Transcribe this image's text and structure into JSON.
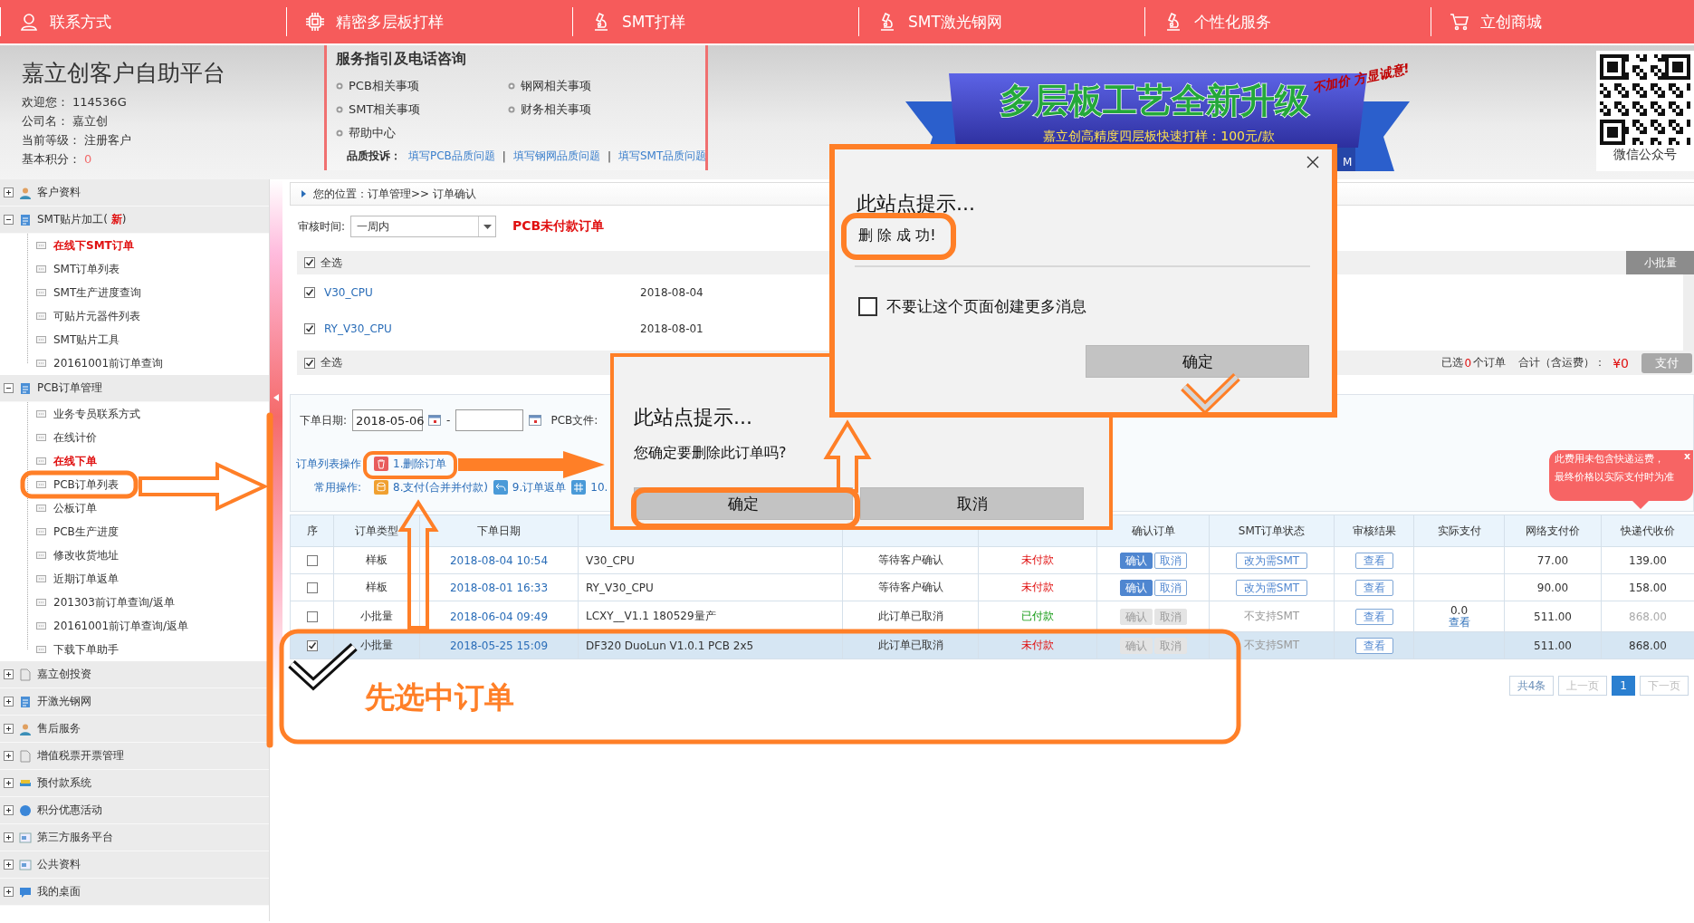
{
  "top_nav": [
    {
      "label": "联系方式"
    },
    {
      "label": "精密多层板打样"
    },
    {
      "label": "SMT打样"
    },
    {
      "label": "SMT激光钢网"
    },
    {
      "label": "个性化服务"
    },
    {
      "label": "立创商城"
    }
  ],
  "account": {
    "title": "嘉立创客户自助平台",
    "fields": [
      {
        "label": "欢迎您：",
        "value": "114536G",
        "kind": "plain"
      },
      {
        "label": "公司名：",
        "value": "嘉立创",
        "kind": "plain"
      },
      {
        "label": "当前等级：",
        "value": "注册客户",
        "kind": "plain"
      },
      {
        "label": "基本积分：",
        "value": "0",
        "kind": "score"
      }
    ]
  },
  "service": {
    "title": "服务指引及电话咨询",
    "links": [
      "PCB相关事项",
      "钢网相关事项",
      "SMT相关事项",
      "财务相关事项",
      "帮助中心"
    ],
    "complaint_label": "品质投诉：",
    "complaint_links": [
      "填写PCB品质问题",
      "填写钢网品质问题",
      "填写SMT品质问题"
    ],
    "complaint_separators": [
      "|",
      "|"
    ]
  },
  "banner": {
    "tag": "不加价 方显诚意!",
    "title": "多层板工艺全新升级",
    "subtitle": "嘉立创高精度四层板快速打样：100元/款",
    "tail": "M"
  },
  "qr": {
    "caption": "微信公众号"
  },
  "sidebar": [
    {
      "label": "客户资料",
      "expanded": false
    },
    {
      "label": "SMT贴片加工( **新**)",
      "expanded": true,
      "children": [
        {
          "label": "在线下SMT订单",
          "emphasis": true
        },
        {
          "label": "SMT订单列表",
          "emphasis": false
        },
        {
          "label": "SMT生产进度查询",
          "emphasis": false
        },
        {
          "label": "可贴片元器件列表",
          "emphasis": false
        },
        {
          "label": "SMT贴片工具",
          "emphasis": false
        },
        {
          "label": "20161001前订单查询",
          "emphasis": false
        }
      ]
    },
    {
      "label": "PCB订单管理",
      "expanded": true,
      "children": [
        {
          "label": "业务专员联系方式",
          "emphasis": false
        },
        {
          "label": "在线计价",
          "emphasis": false
        },
        {
          "label": "在线下单",
          "emphasis": true
        },
        {
          "label": "PCB订单列表",
          "emphasis": false
        },
        {
          "label": "公板订单",
          "emphasis": false
        },
        {
          "label": "PCB生产进度",
          "emphasis": false
        },
        {
          "label": "修改收货地址",
          "emphasis": false
        },
        {
          "label": "近期订单返单",
          "emphasis": false
        },
        {
          "label": "201303前订单查询/返单",
          "emphasis": false
        },
        {
          "label": "20161001前订单查询/返单",
          "emphasis": false
        },
        {
          "label": "下载下单助手",
          "emphasis": false
        }
      ]
    },
    {
      "label": "嘉立创投资",
      "expanded": false
    },
    {
      "label": "开激光钢网",
      "expanded": false
    },
    {
      "label": "售后服务",
      "expanded": false
    },
    {
      "label": "增值税票开票管理",
      "expanded": false
    },
    {
      "label": "预付款系统",
      "expanded": false
    },
    {
      "label": "积分优惠活动",
      "expanded": false
    },
    {
      "label": "第三方服务平台",
      "expanded": false
    },
    {
      "label": "公共资料",
      "expanded": false
    },
    {
      "label": "我的桌面",
      "expanded": false
    }
  ],
  "breadcrumb": "您的位置：订单管理>> 订单确认",
  "filter": {
    "label": "审核时间:",
    "value": "一周内",
    "heading": "PCB未付款订单"
  },
  "cart": {
    "select_all": {
      "label": "全选",
      "checked": true
    },
    "tab": "小批量",
    "items": [
      {
        "name": "V30_CPU",
        "date": "2018-08-04",
        "checked": true
      },
      {
        "name": "RY_V30_CPU",
        "date": "2018-08-01",
        "checked": true
      }
    ],
    "footer_select_all": {
      "label": "全选",
      "checked": true
    },
    "summary": {
      "prefix": "已选",
      "count": "0",
      "suffix": "个订单",
      "total_label": "合计（含运费）：",
      "total": "¥0",
      "pay_button": "支付"
    }
  },
  "search": {
    "date_label": "下单日期:",
    "date_from": "2018-05-06",
    "date_separator": "-",
    "file_label": "PCB文件:"
  },
  "operations": {
    "list_label": "订单列表操作",
    "list_actions": [
      {
        "label": "1.删除订单"
      }
    ],
    "common_label": "常用操作:",
    "common_actions": [
      {
        "label": "8.支付(合并并付款)"
      },
      {
        "label": "9.订单返单"
      },
      {
        "label": "10."
      }
    ]
  },
  "tooltip": {
    "lines": [
      "此费用未包含快递运费，",
      "最终价格以实际支付时为准"
    ],
    "close": "x"
  },
  "table": {
    "columns": [
      {
        "label": "序"
      },
      {
        "label": "订单类型"
      },
      {
        "label": "下单日期"
      },
      {},
      {},
      {},
      {
        "label": "确认订单"
      },
      {
        "label": "SMT订单状态"
      },
      {
        "label": "审核结果"
      },
      {
        "label": "实际支付"
      },
      {
        "label": "网络支付价"
      },
      {
        "label": "快递代收价"
      }
    ],
    "rows": [
      {
        "selected": false,
        "checked": false,
        "type": "样板",
        "date": "2018-08-04 10:54",
        "name": "V30_CPU",
        "status": "等待客户确认",
        "payment": "未付款",
        "paid": false,
        "confirm": "确认",
        "cancel": "取消",
        "actions_enabled": true,
        "smt": {
          "kind": "button",
          "label": "改为需SMT"
        },
        "review": "查看",
        "net_price": "77.00",
        "shipping": "139.00",
        "shipping_muted": false
      },
      {
        "selected": false,
        "checked": false,
        "type": "样板",
        "date": "2018-08-01 16:33",
        "name": "RY_V30_CPU",
        "status": "等待客户确认",
        "payment": "未付款",
        "paid": false,
        "confirm": "确认",
        "cancel": "取消",
        "actions_enabled": true,
        "smt": {
          "kind": "button",
          "label": "改为需SMT"
        },
        "review": "查看",
        "net_price": "90.00",
        "shipping": "158.00",
        "shipping_muted": false
      },
      {
        "selected": false,
        "checked": false,
        "type": "小批量",
        "date": "2018-06-04 09:49",
        "name": "LCXY__V1.1 180529量产",
        "status": "此订单已取消",
        "payment": "已付款",
        "paid": true,
        "confirm": "确认",
        "cancel": "取消",
        "actions_enabled": false,
        "smt": {
          "kind": "text",
          "label": "不支持SMT"
        },
        "review": "查看",
        "actual": "0.0",
        "actual_link": "查看",
        "net_price": "511.00",
        "shipping": "868.00",
        "shipping_muted": true
      },
      {
        "selected": true,
        "checked": true,
        "type": "小批量",
        "date": "2018-05-25 15:09",
        "name": "DF320 DuoLun V1.0.1 PCB 2x5",
        "status": "此订单已取消",
        "payment": "未付款",
        "paid": false,
        "confirm": "确认",
        "cancel": "取消",
        "actions_enabled": false,
        "smt": {
          "kind": "text",
          "label": "不支持SMT"
        },
        "review": "查看",
        "net_price": "511.00",
        "shipping": "868.00",
        "shipping_muted": false
      }
    ]
  },
  "pagination": {
    "total": "共4条",
    "prev": "上一页",
    "pages": [
      {
        "label": "1",
        "selected": true
      }
    ],
    "next": "下一页"
  },
  "dialogs": [
    {
      "kind": "confirm",
      "title": "此站点提示...",
      "message": "您确定要删除此订单吗?",
      "buttons": [
        "确定",
        "取消"
      ]
    },
    {
      "kind": "alert",
      "title": "此站点提示...",
      "message": "删 除 成 功!",
      "checkbox": {
        "label": "不要让这个页面创建更多消息",
        "checked": false
      },
      "buttons": [
        "确定"
      ]
    }
  ],
  "annotation": {
    "caption": "先选中订单"
  }
}
